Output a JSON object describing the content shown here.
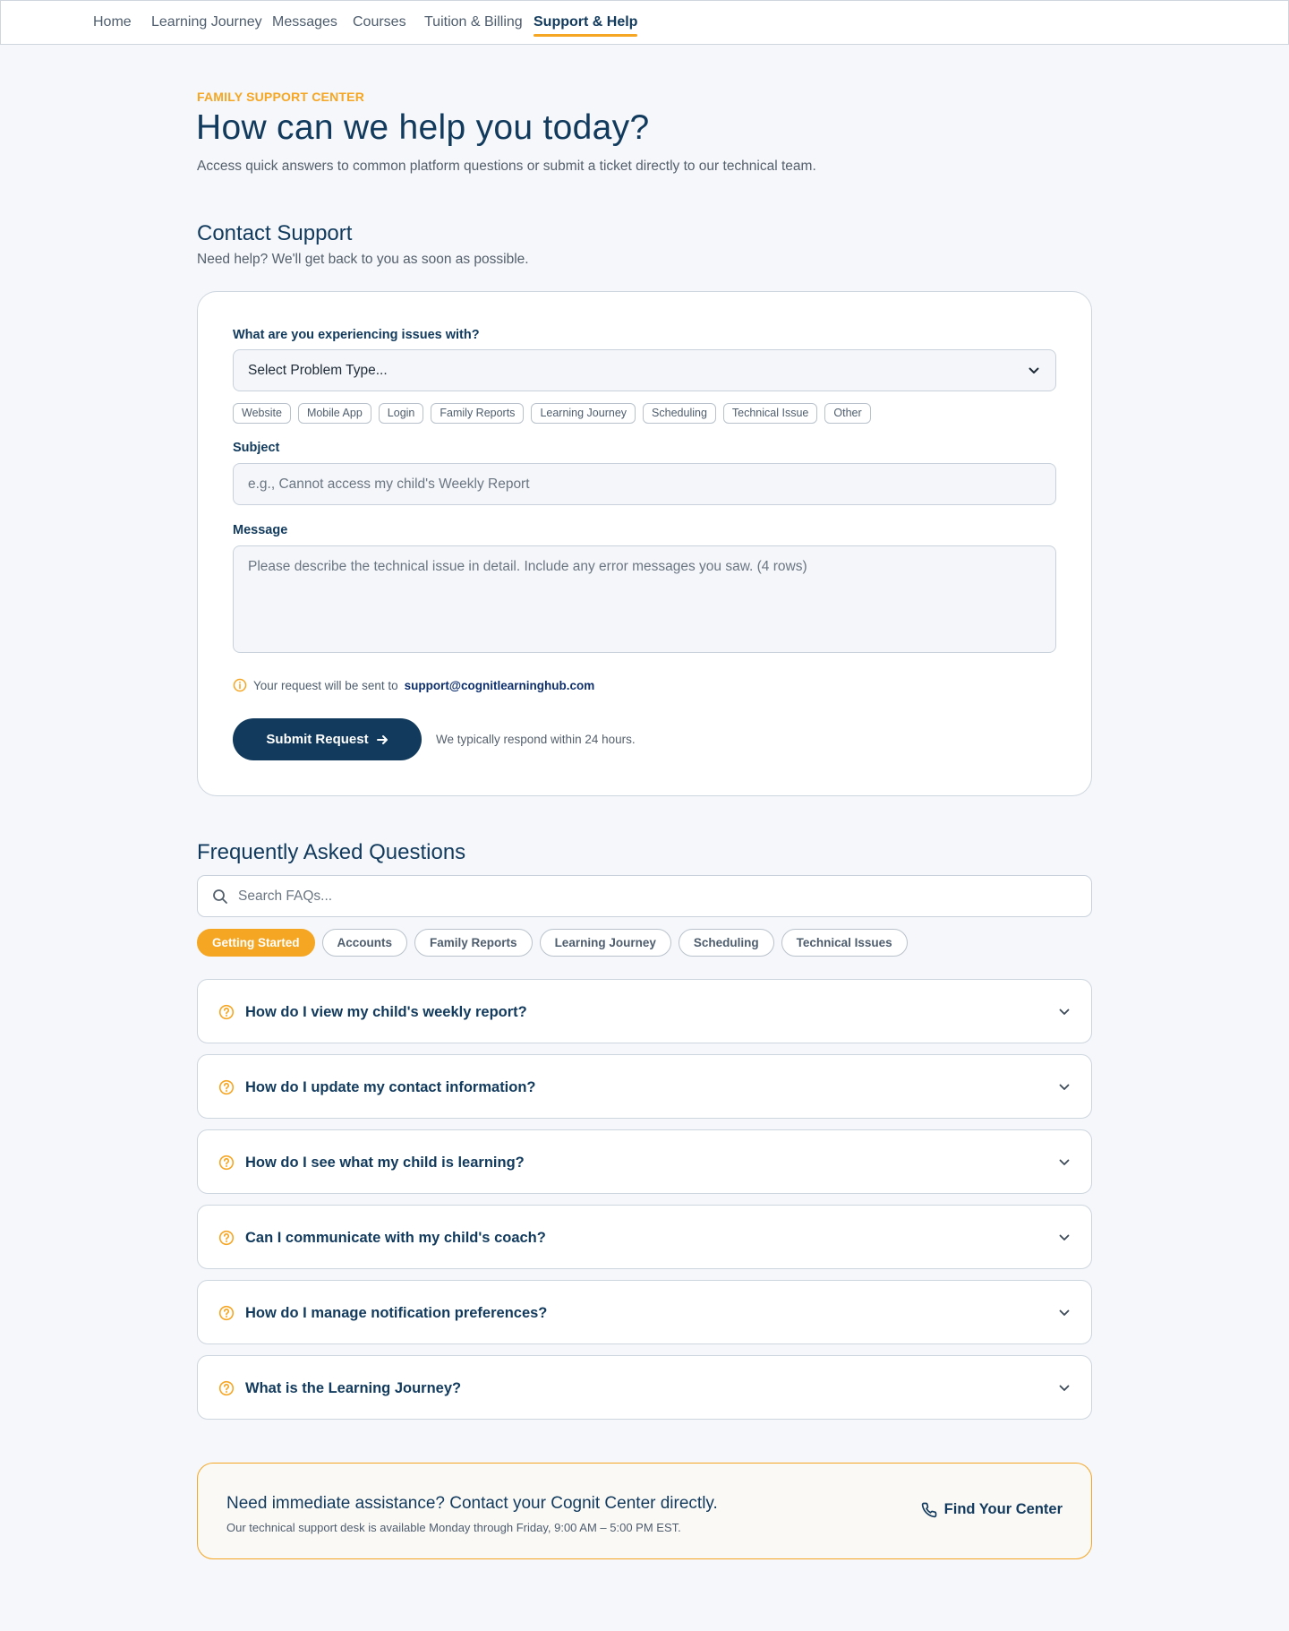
{
  "nav": {
    "items": [
      {
        "label": "Home"
      },
      {
        "label": "Learning Journey"
      },
      {
        "label": "Messages"
      },
      {
        "label": "Courses"
      },
      {
        "label": "Tuition & Billing"
      },
      {
        "label": "Support & Help",
        "active": true
      }
    ]
  },
  "hero": {
    "eyebrow": "FAMILY SUPPORT CENTER",
    "title": "How can we help you today?",
    "subtitle": "Access quick answers to common platform questions or submit a ticket directly to our technical team."
  },
  "contact": {
    "title": "Contact Support",
    "subtitle": "Need help? We'll get back to you as soon as possible.",
    "problem_label": "What are you experiencing issues with?",
    "problem_select_value": "Select Problem Type...",
    "problem_chips": [
      "Website",
      "Mobile App",
      "Login",
      "Family Reports",
      "Learning Journey",
      "Scheduling",
      "Technical Issue",
      "Other"
    ],
    "subject_label": "Subject",
    "subject_placeholder": "e.g., Cannot access my child's Weekly Report",
    "message_label": "Message",
    "message_placeholder": "Please describe the technical issue in detail. Include any error messages you saw. (4 rows)",
    "note_prefix": "Your request will be sent to",
    "note_email": "support@cognitlearninghub.com",
    "submit_label": "Submit Request",
    "response_note": "We typically respond within 24 hours."
  },
  "faq": {
    "title": "Frequently Asked Questions",
    "search_placeholder": "Search FAQs...",
    "tabs": [
      {
        "label": "Getting Started",
        "active": true
      },
      {
        "label": "Accounts"
      },
      {
        "label": "Family Reports"
      },
      {
        "label": "Learning Journey"
      },
      {
        "label": "Scheduling"
      },
      {
        "label": "Technical Issues"
      }
    ],
    "questions": [
      "How do I view my child's weekly report?",
      "How do I update my contact information?",
      "How do I see what my child is learning?",
      "Can I communicate with my child's coach?",
      "How do I manage notification preferences?",
      "What is the Learning Journey?"
    ]
  },
  "cta": {
    "title": "Need immediate assistance? Contact your Cognit Center directly.",
    "subtitle": "Our technical support desk is available Monday through Friday, 9:00 AM – 5:00 PM EST.",
    "button_label": "Find Your Center",
    "button_icon": "phone-icon"
  },
  "colors": {
    "primary": "#113a5d",
    "accent": "#f5a623",
    "background": "#f5f7fa"
  }
}
